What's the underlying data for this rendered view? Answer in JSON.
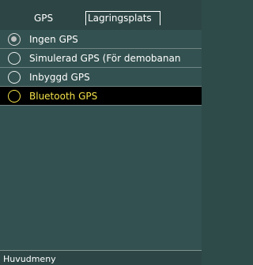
{
  "tabs": [
    {
      "label": "GPS",
      "active": true
    },
    {
      "label": "Lagringsplats",
      "active": false
    }
  ],
  "options": [
    {
      "label": "Ingen GPS",
      "checked": true,
      "highlighted": false
    },
    {
      "label": "Simulerad GPS (För demobanan",
      "checked": false,
      "highlighted": false
    },
    {
      "label": "Inbyggd GPS",
      "checked": false,
      "highlighted": false
    },
    {
      "label": "Bluetooth GPS",
      "checked": false,
      "highlighted": true
    }
  ],
  "footer": {
    "label": "Huvudmeny"
  },
  "colors": {
    "background": "#335150",
    "highlight_bg": "#000000",
    "highlight_text": "#f3e14a",
    "text": "#ffffff"
  }
}
